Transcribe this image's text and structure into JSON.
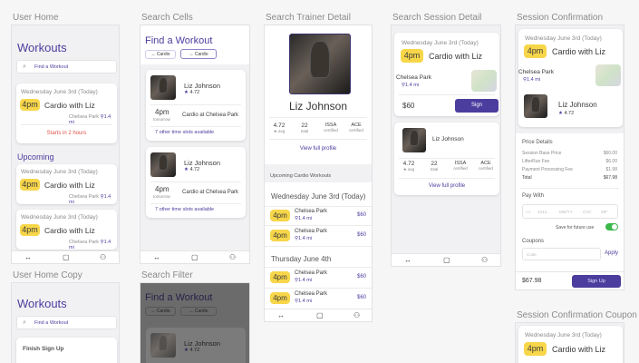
{
  "labels": {
    "user_home": "User Home",
    "search_cells": "Search Cells",
    "search_trainer_detail": "Search Trainer Detail",
    "search_session_detail": "Search Session Detail",
    "session_confirmation": "Session Confirmation",
    "user_home_copy": "User Home Copy",
    "search_filter": "Search Filter",
    "session_confirmation_coupon": "Session Confirmation Coupon"
  },
  "user_home": {
    "title": "Workouts",
    "search_placeholder": "Find a Workout",
    "next": {
      "date": "Wednesday June 3rd (Today)",
      "time": "4pm",
      "title": "Cardio with Liz",
      "location": "Chelsea Park",
      "distance": "1.4 mi",
      "starts": "Starts in 2 hours"
    },
    "upcoming_label": "Upcoming",
    "upcoming": [
      {
        "date": "Wednesday June 3rd (Today)",
        "time": "4pm",
        "title": "Cardio with Liz",
        "location": "Chelsea Park",
        "distance": "1.4 mi"
      },
      {
        "date": "Wednesday June 3rd (Today)",
        "time": "4pm",
        "title": "Cardio with Liz",
        "location": "Chelsea Park",
        "distance": "1.4 mi"
      }
    ]
  },
  "user_home_copy": {
    "title": "Workouts",
    "search_placeholder": "Find a Workout",
    "finish_signup": "Finish Sign Up"
  },
  "search_cells": {
    "title": "Find a Workout",
    "filter1": "Cardio",
    "filter2": "Cardio",
    "cards": [
      {
        "name": "Liz Johnson",
        "rating": "4.72",
        "time": "4pm",
        "time_sub": "tomorrow",
        "session": "Cardio at Chelsea Park",
        "more": "7 other time slots available"
      },
      {
        "name": "Liz Johnson",
        "rating": "4.72",
        "time": "4pm",
        "time_sub": "tomorrow",
        "session": "Cardio at Chelsea Park",
        "more": "7 other time slots available"
      }
    ]
  },
  "search_filter": {
    "title": "Find a Workout",
    "filter1": "Cardio",
    "filter2": "Cardio",
    "name": "Liz Johnson",
    "rating": "4.72"
  },
  "trainer_detail": {
    "name": "Liz Johnson",
    "stats": [
      {
        "value": "4.72",
        "label": "★ avg"
      },
      {
        "value": "22",
        "label": "total"
      },
      {
        "value": "ISSA",
        "label": "certified"
      },
      {
        "value": "ACE",
        "label": "certified"
      }
    ],
    "view_profile": "View full profile",
    "upcoming_header": "Upcoming Cardio Workouts",
    "day1": "Wednesday June 3rd (Today)",
    "day2": "Thursday June 4th",
    "slots": [
      {
        "time": "4pm",
        "location": "Chelsea Park",
        "distance": "1.4 mi",
        "price": "$60"
      },
      {
        "time": "4pm",
        "location": "Chelsea Park",
        "distance": "1.4 mi",
        "price": "$60"
      },
      {
        "time": "4pm",
        "location": "Chelsea Park",
        "distance": "1.4 mi",
        "price": "$60"
      },
      {
        "time": "4pm",
        "location": "Chelsea Park",
        "distance": "1.4 mi",
        "price": "$60"
      }
    ]
  },
  "session_detail": {
    "date": "Wednesday June 3rd (Today)",
    "time": "4pm",
    "title": "Cardio with Liz",
    "location": "Chelsea Park",
    "distance": "1.4 mi",
    "price": "$60",
    "signup": "Sign",
    "trainer": "Liz Johnson",
    "stats": [
      {
        "value": "4.72",
        "label": "★ avg"
      },
      {
        "value": "22",
        "label": "total"
      },
      {
        "value": "ISSA",
        "label": "certified"
      },
      {
        "value": "ACE",
        "label": "certified"
      }
    ],
    "view_profile": "View full profile"
  },
  "confirmation": {
    "date": "Wednesday June 3rd (Today)",
    "time": "4pm",
    "title": "Cardio with Liz",
    "location": "Chelsea Park",
    "distance": "1.4 mi",
    "trainer": "Liz Johnson",
    "rating": "4.72",
    "price_details": "Price Details",
    "price_rows": [
      {
        "label": "Session Base Price",
        "value": "$60.00"
      },
      {
        "label": "LifterRun Fee",
        "value": "$6.00"
      },
      {
        "label": "Payment Processing Fee",
        "value": "$1.98"
      },
      {
        "label": "Total",
        "value": "$67.98"
      }
    ],
    "pay_with": "Pay With",
    "card_placeholders": [
      "4242...",
      "MM/YY",
      "CVC",
      "ZIP"
    ],
    "save_future": "Save for future use",
    "coupons": "Coupons",
    "code_placeholder": "Code",
    "apply": "Apply",
    "total": "$67.98",
    "signup": "Sign Up"
  },
  "coupon": {
    "date": "Wednesday June 3rd (Today)",
    "time": "4pm",
    "title": "Cardio with Liz"
  },
  "tabs": {
    "swap": "↔",
    "chat": "▢",
    "user": "⚇"
  },
  "colors": {
    "accent": "#4b3d9e",
    "time_pill": "#f7d64a",
    "alert": "#e0524a",
    "toggle": "#3cb84a"
  }
}
